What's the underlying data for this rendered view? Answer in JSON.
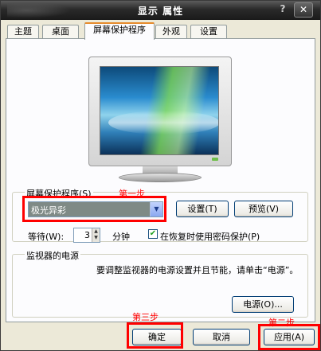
{
  "window": {
    "title": "显示 属性",
    "help_label": "?",
    "close_label": "✕"
  },
  "tabs": [
    {
      "label": "主题"
    },
    {
      "label": "桌面"
    },
    {
      "label": "屏幕保护程序"
    },
    {
      "label": "外观"
    },
    {
      "label": "设置"
    }
  ],
  "screensaver": {
    "group_label": "屏幕保护程序(S)",
    "selected_value": "极光异彩",
    "settings_button": "设置(T)",
    "preview_button": "预览(V)",
    "wait_label": "等待(W):",
    "wait_value": "3",
    "wait_unit": "分钟",
    "resume_password_label": "在恢复时使用密码保护(P)",
    "resume_password_checked": "✔"
  },
  "power": {
    "group_label": "监视器的电源",
    "description": "要调整监视器的电源设置并且节能，请单击“电源”。",
    "power_button": "电源(O)..."
  },
  "footer": {
    "ok_button": "确定",
    "cancel_button": "取消",
    "apply_button": "应用(A)"
  },
  "annotations": {
    "step1": "第一步",
    "step2": "第二步",
    "step3": "第三步",
    "color": "#ff0000"
  },
  "icons": {
    "monitor_preview": "monitor-preview-icon",
    "dropdown_arrow": "chevron-down-icon",
    "spin": "spin-updown-icon",
    "check": "checkmark-icon"
  }
}
